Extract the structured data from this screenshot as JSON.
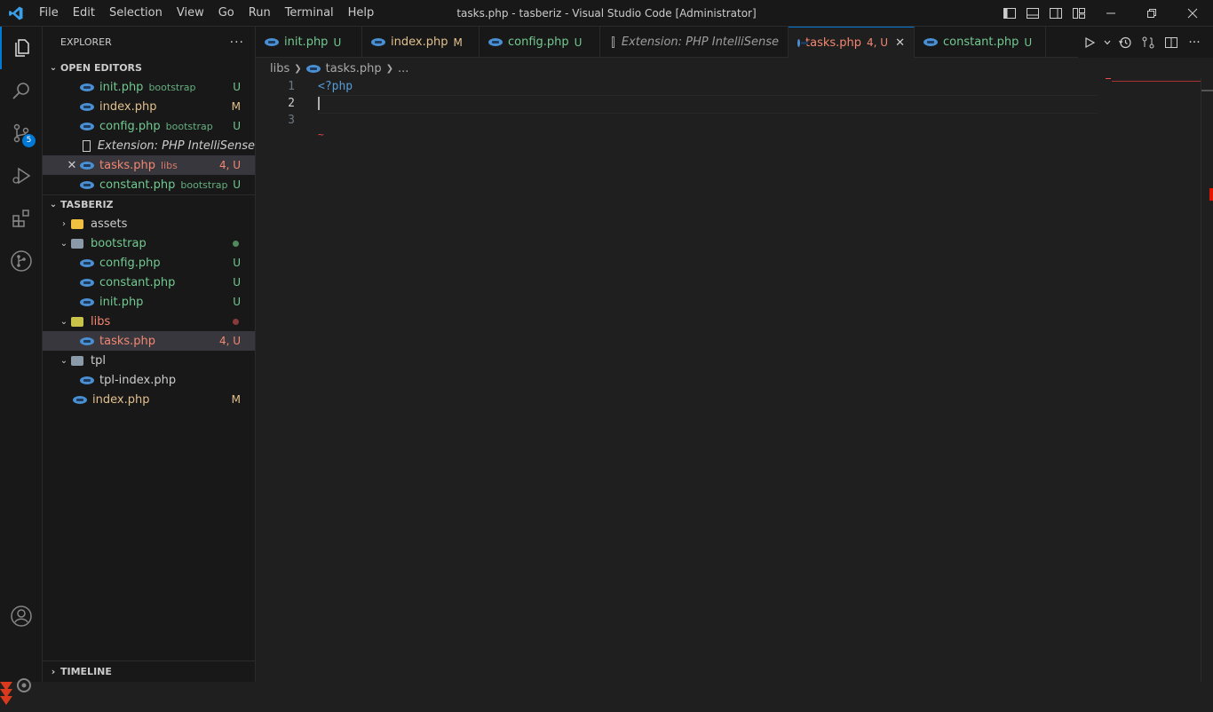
{
  "window": {
    "title": "tasks.php - tasberiz - Visual Studio Code [Administrator]",
    "menu": [
      "File",
      "Edit",
      "Selection",
      "View",
      "Go",
      "Run",
      "Terminal",
      "Help"
    ]
  },
  "activity": {
    "source_control_badge": "5"
  },
  "explorer": {
    "title": "EXPLORER",
    "more": "···",
    "open_editors_title": "OPEN EDITORS",
    "open_editors": [
      {
        "name": "init.php",
        "desc": "bootstrap",
        "status": "U",
        "color": "#73c991"
      },
      {
        "name": "index.php",
        "desc": "",
        "status": "M",
        "color": "#e2c08d"
      },
      {
        "name": "config.php",
        "desc": "bootstrap",
        "status": "U",
        "color": "#73c991"
      },
      {
        "name": "Extension: PHP IntelliSense",
        "desc": "",
        "status": "",
        "color": "#cccccc"
      },
      {
        "name": "tasks.php",
        "desc": "libs",
        "status": "4, U",
        "color": "#f48771"
      },
      {
        "name": "constant.php",
        "desc": "bootstrap",
        "status": "U",
        "color": "#73c991"
      }
    ],
    "project_title": "TASBERIZ",
    "tree": {
      "assets": "assets",
      "bootstrap": "bootstrap",
      "config": "config.php",
      "constant": "constant.php",
      "init": "init.php",
      "libs": "libs",
      "tasks": "tasks.php",
      "tpl": "tpl",
      "tpl_index": "tpl-index.php",
      "index": "index.php",
      "status_u": "U",
      "status_m": "M",
      "status_tasks": "4, U"
    },
    "timeline_title": "TIMELINE"
  },
  "tabs": [
    {
      "name": "init.php",
      "status": "U",
      "color": "#73c991"
    },
    {
      "name": "index.php",
      "status": "M",
      "color": "#e2c08d"
    },
    {
      "name": "config.php",
      "status": "U",
      "color": "#73c991"
    },
    {
      "name": "Extension: PHP IntelliSense",
      "status": "",
      "color": "#cccccc"
    },
    {
      "name": "tasks.php",
      "status": "4, U",
      "color": "#f48771"
    },
    {
      "name": "constant.php",
      "status": "U",
      "color": "#73c991"
    }
  ],
  "breadcrumb": {
    "folder": "libs",
    "file": "tasks.php",
    "more": "..."
  },
  "editor": {
    "lines": [
      {
        "num": "1",
        "text": "<?php"
      },
      {
        "num": "2",
        "text": ""
      },
      {
        "num": "3",
        "text": ""
      }
    ],
    "squiggle": "~"
  }
}
